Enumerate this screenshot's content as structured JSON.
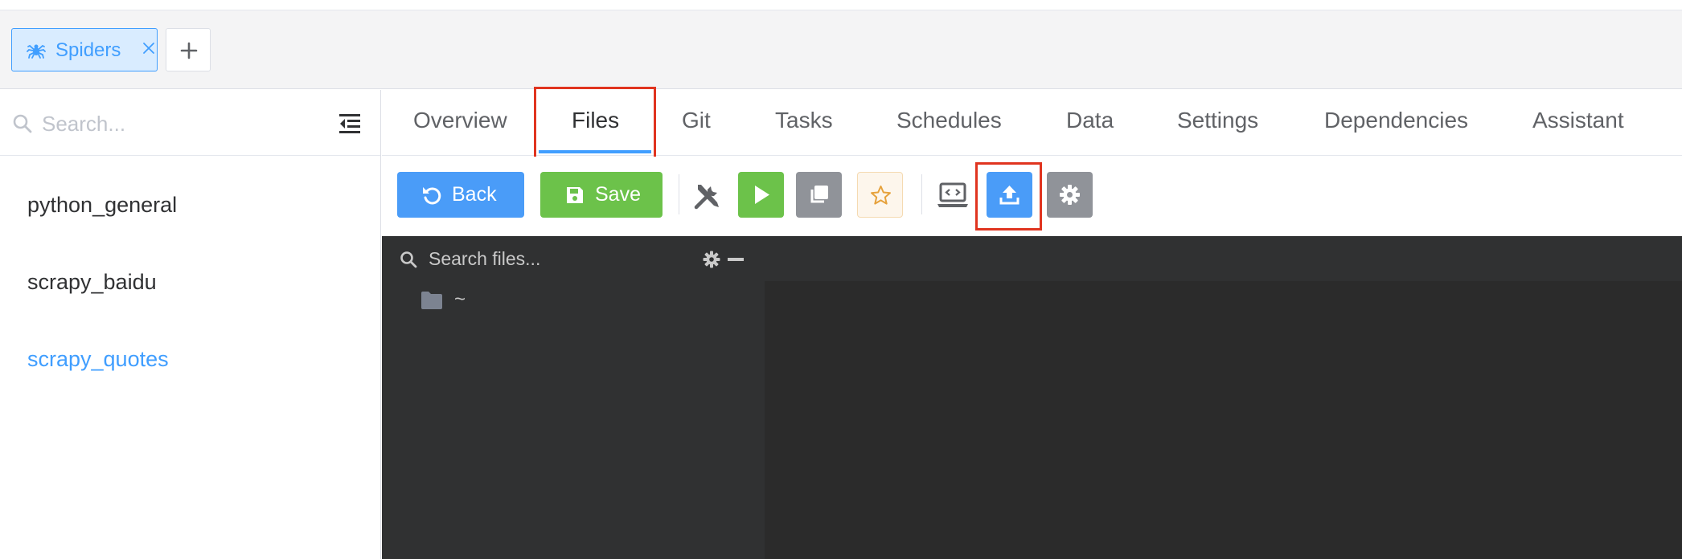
{
  "tabs": {
    "spider_tab_label": "Spiders",
    "close_glyph": "×",
    "add_icon": "plus-icon"
  },
  "sidebar": {
    "search_placeholder": "Search...",
    "items": [
      {
        "label": "python_general",
        "active": false
      },
      {
        "label": "scrapy_baidu",
        "active": false
      },
      {
        "label": "scrapy_quotes",
        "active": true
      }
    ]
  },
  "nav": {
    "tabs": [
      {
        "label": "Overview",
        "active": false
      },
      {
        "label": "Files",
        "active": true
      },
      {
        "label": "Git",
        "active": false
      },
      {
        "label": "Tasks",
        "active": false
      },
      {
        "label": "Schedules",
        "active": false
      },
      {
        "label": "Data",
        "active": false
      },
      {
        "label": "Settings",
        "active": false
      },
      {
        "label": "Dependencies",
        "active": false
      },
      {
        "label": "Assistant",
        "active": false
      }
    ]
  },
  "toolbar": {
    "back_label": "Back",
    "save_label": "Save",
    "icons": [
      "tools-icon",
      "play-icon",
      "copy-icon",
      "star-icon",
      "ide-icon",
      "upload-icon",
      "gear-icon"
    ]
  },
  "file_panel": {
    "search_placeholder": "Search files...",
    "root_label": "~"
  },
  "colors": {
    "primary": "#409eff",
    "success": "#6cc24a",
    "info": "#909399",
    "warning_bg": "#fdf6ec",
    "highlight": "#e0341f",
    "dark_panel": "#303132",
    "editor_bg": "#2b2b2b"
  }
}
